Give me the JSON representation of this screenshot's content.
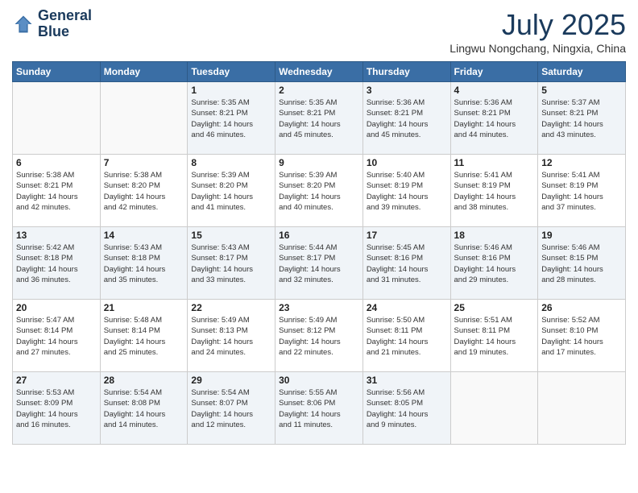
{
  "header": {
    "logo_line1": "General",
    "logo_line2": "Blue",
    "month_title": "July 2025",
    "subtitle": "Lingwu Nongchang, Ningxia, China"
  },
  "weekdays": [
    "Sunday",
    "Monday",
    "Tuesday",
    "Wednesday",
    "Thursday",
    "Friday",
    "Saturday"
  ],
  "weeks": [
    [
      {
        "day": "",
        "info": ""
      },
      {
        "day": "",
        "info": ""
      },
      {
        "day": "1",
        "info": "Sunrise: 5:35 AM\nSunset: 8:21 PM\nDaylight: 14 hours\nand 46 minutes."
      },
      {
        "day": "2",
        "info": "Sunrise: 5:35 AM\nSunset: 8:21 PM\nDaylight: 14 hours\nand 45 minutes."
      },
      {
        "day": "3",
        "info": "Sunrise: 5:36 AM\nSunset: 8:21 PM\nDaylight: 14 hours\nand 45 minutes."
      },
      {
        "day": "4",
        "info": "Sunrise: 5:36 AM\nSunset: 8:21 PM\nDaylight: 14 hours\nand 44 minutes."
      },
      {
        "day": "5",
        "info": "Sunrise: 5:37 AM\nSunset: 8:21 PM\nDaylight: 14 hours\nand 43 minutes."
      }
    ],
    [
      {
        "day": "6",
        "info": "Sunrise: 5:38 AM\nSunset: 8:21 PM\nDaylight: 14 hours\nand 42 minutes."
      },
      {
        "day": "7",
        "info": "Sunrise: 5:38 AM\nSunset: 8:20 PM\nDaylight: 14 hours\nand 42 minutes."
      },
      {
        "day": "8",
        "info": "Sunrise: 5:39 AM\nSunset: 8:20 PM\nDaylight: 14 hours\nand 41 minutes."
      },
      {
        "day": "9",
        "info": "Sunrise: 5:39 AM\nSunset: 8:20 PM\nDaylight: 14 hours\nand 40 minutes."
      },
      {
        "day": "10",
        "info": "Sunrise: 5:40 AM\nSunset: 8:19 PM\nDaylight: 14 hours\nand 39 minutes."
      },
      {
        "day": "11",
        "info": "Sunrise: 5:41 AM\nSunset: 8:19 PM\nDaylight: 14 hours\nand 38 minutes."
      },
      {
        "day": "12",
        "info": "Sunrise: 5:41 AM\nSunset: 8:19 PM\nDaylight: 14 hours\nand 37 minutes."
      }
    ],
    [
      {
        "day": "13",
        "info": "Sunrise: 5:42 AM\nSunset: 8:18 PM\nDaylight: 14 hours\nand 36 minutes."
      },
      {
        "day": "14",
        "info": "Sunrise: 5:43 AM\nSunset: 8:18 PM\nDaylight: 14 hours\nand 35 minutes."
      },
      {
        "day": "15",
        "info": "Sunrise: 5:43 AM\nSunset: 8:17 PM\nDaylight: 14 hours\nand 33 minutes."
      },
      {
        "day": "16",
        "info": "Sunrise: 5:44 AM\nSunset: 8:17 PM\nDaylight: 14 hours\nand 32 minutes."
      },
      {
        "day": "17",
        "info": "Sunrise: 5:45 AM\nSunset: 8:16 PM\nDaylight: 14 hours\nand 31 minutes."
      },
      {
        "day": "18",
        "info": "Sunrise: 5:46 AM\nSunset: 8:16 PM\nDaylight: 14 hours\nand 29 minutes."
      },
      {
        "day": "19",
        "info": "Sunrise: 5:46 AM\nSunset: 8:15 PM\nDaylight: 14 hours\nand 28 minutes."
      }
    ],
    [
      {
        "day": "20",
        "info": "Sunrise: 5:47 AM\nSunset: 8:14 PM\nDaylight: 14 hours\nand 27 minutes."
      },
      {
        "day": "21",
        "info": "Sunrise: 5:48 AM\nSunset: 8:14 PM\nDaylight: 14 hours\nand 25 minutes."
      },
      {
        "day": "22",
        "info": "Sunrise: 5:49 AM\nSunset: 8:13 PM\nDaylight: 14 hours\nand 24 minutes."
      },
      {
        "day": "23",
        "info": "Sunrise: 5:49 AM\nSunset: 8:12 PM\nDaylight: 14 hours\nand 22 minutes."
      },
      {
        "day": "24",
        "info": "Sunrise: 5:50 AM\nSunset: 8:11 PM\nDaylight: 14 hours\nand 21 minutes."
      },
      {
        "day": "25",
        "info": "Sunrise: 5:51 AM\nSunset: 8:11 PM\nDaylight: 14 hours\nand 19 minutes."
      },
      {
        "day": "26",
        "info": "Sunrise: 5:52 AM\nSunset: 8:10 PM\nDaylight: 14 hours\nand 17 minutes."
      }
    ],
    [
      {
        "day": "27",
        "info": "Sunrise: 5:53 AM\nSunset: 8:09 PM\nDaylight: 14 hours\nand 16 minutes."
      },
      {
        "day": "28",
        "info": "Sunrise: 5:54 AM\nSunset: 8:08 PM\nDaylight: 14 hours\nand 14 minutes."
      },
      {
        "day": "29",
        "info": "Sunrise: 5:54 AM\nSunset: 8:07 PM\nDaylight: 14 hours\nand 12 minutes."
      },
      {
        "day": "30",
        "info": "Sunrise: 5:55 AM\nSunset: 8:06 PM\nDaylight: 14 hours\nand 11 minutes."
      },
      {
        "day": "31",
        "info": "Sunrise: 5:56 AM\nSunset: 8:05 PM\nDaylight: 14 hours\nand 9 minutes."
      },
      {
        "day": "",
        "info": ""
      },
      {
        "day": "",
        "info": ""
      }
    ]
  ]
}
